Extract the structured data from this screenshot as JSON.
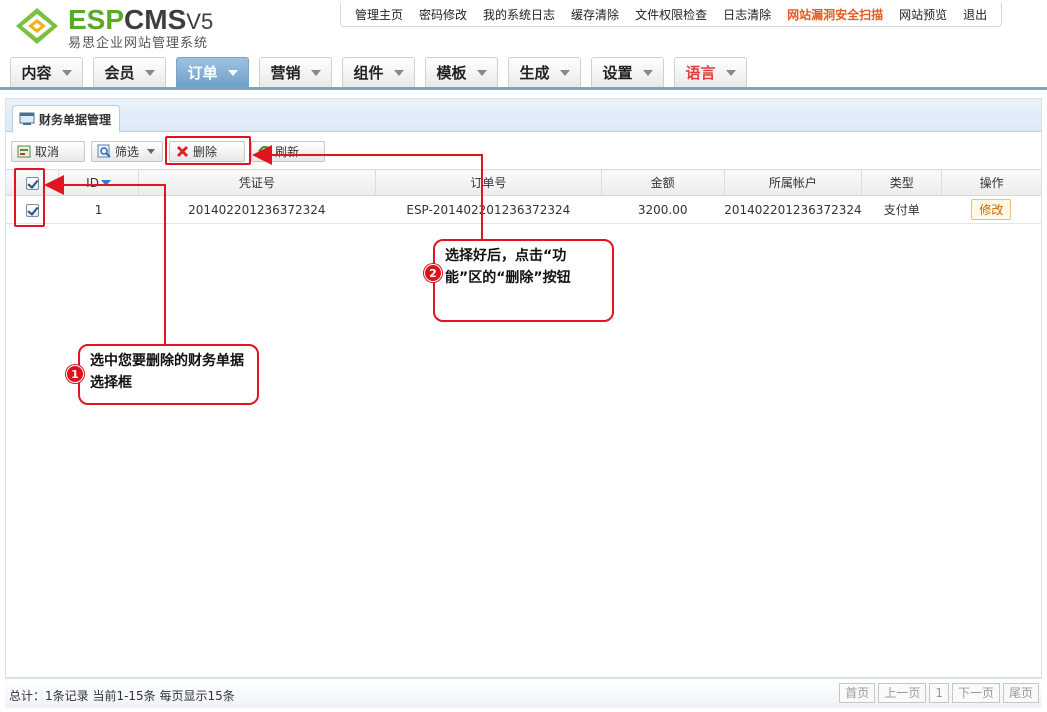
{
  "logo": {
    "esp": "ESP",
    "cms": "CMS",
    "version": "V5",
    "subtitle": "易思企业网站管理系统"
  },
  "top_nav": [
    {
      "label": "管理主页"
    },
    {
      "label": "密码修改"
    },
    {
      "label": "我的系统日志"
    },
    {
      "label": "缓存清除"
    },
    {
      "label": "文件权限检查"
    },
    {
      "label": "日志清除"
    },
    {
      "label": "网站漏洞安全扫描",
      "highlight": true
    },
    {
      "label": "网站预览"
    },
    {
      "label": "退出"
    }
  ],
  "main_tabs": [
    {
      "label": "内容"
    },
    {
      "label": "会员"
    },
    {
      "label": "订单",
      "active": true
    },
    {
      "label": "营销"
    },
    {
      "label": "组件"
    },
    {
      "label": "模板"
    },
    {
      "label": "生成"
    },
    {
      "label": "设置"
    },
    {
      "label": "语言",
      "red": true
    }
  ],
  "panel": {
    "title": "财务单据管理"
  },
  "toolbar": {
    "cancel": "取消",
    "filter": "筛选",
    "delete": "删除",
    "refresh": "刷新"
  },
  "table": {
    "headers": [
      "ID",
      "凭证号",
      "订单号",
      "金额",
      "所属帐户",
      "类型",
      "操作"
    ],
    "rows": [
      {
        "id": "1",
        "voucher": "201402201236372324",
        "order": "ESP-201402201236372324",
        "amount": "3200.00",
        "account": "201402201236372324",
        "type": "支付单",
        "action": "修改"
      }
    ]
  },
  "footer": {
    "info": "总计：1条记录 当前1-15条 每页显示15条",
    "pager": [
      "首页",
      "上一页",
      "1",
      "下一页",
      "尾页"
    ]
  },
  "annotations": {
    "callout1": {
      "badge": "1",
      "text": "选中您要删除的财务单据选择框"
    },
    "callout2": {
      "badge": "2",
      "text": "选择好后，点击“功能”区的“删除”按钮"
    }
  },
  "colors": {
    "accent_blue": "#6fa0c8",
    "logo_green": "#5aa928",
    "annotation_red": "#e0151f",
    "warn_orange": "#e35b1e"
  }
}
